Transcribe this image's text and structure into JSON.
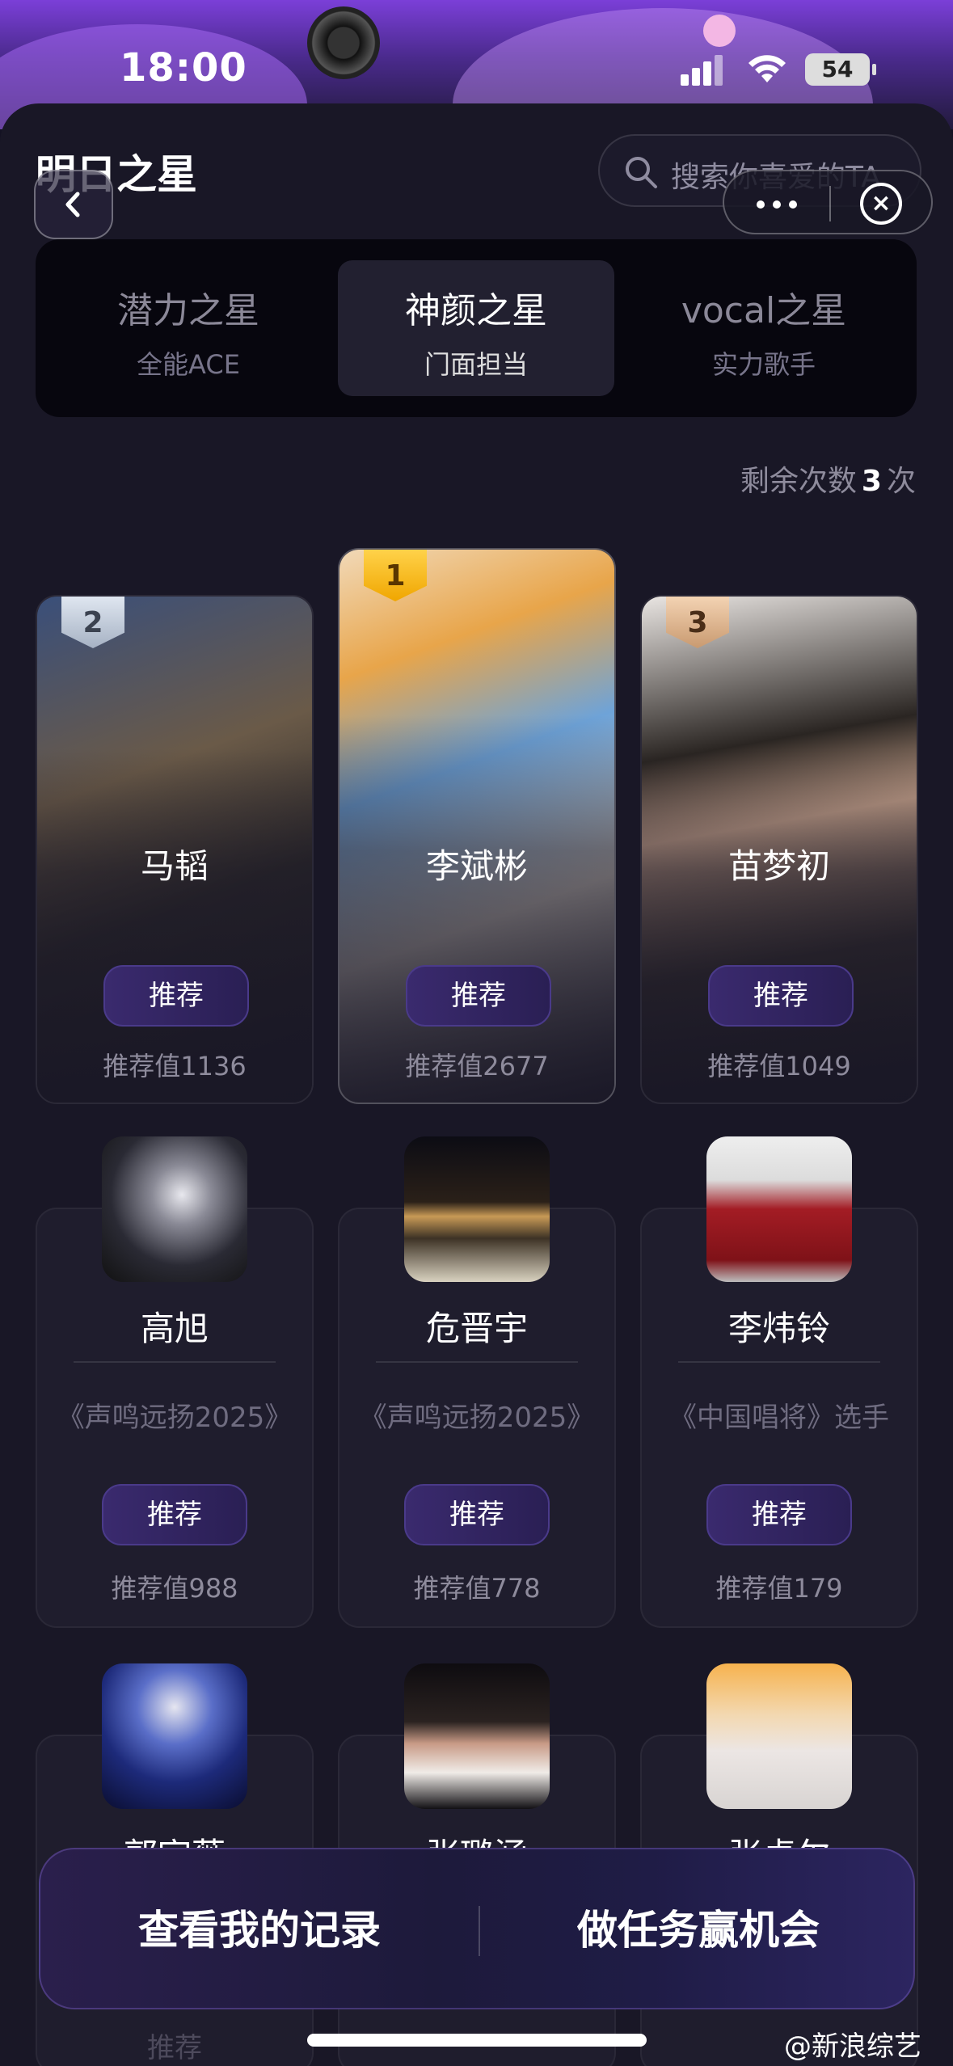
{
  "status": {
    "time": "18:00",
    "battery": "54"
  },
  "header": {
    "title": "明日之星",
    "search_placeholder": "搜索你喜爱的TA"
  },
  "tabs": [
    {
      "title": "潜力之星",
      "subtitle": "全能ACE"
    },
    {
      "title": "神颜之星",
      "subtitle": "门面担当",
      "active": true
    },
    {
      "title": "vocal之星",
      "subtitle": "实力歌手"
    }
  ],
  "remaining": {
    "prefix": "剩余次数",
    "count": "3",
    "suffix": "次"
  },
  "top3": [
    {
      "rank": "2",
      "name": "马韬",
      "button": "推荐",
      "score": "推荐值1136"
    },
    {
      "rank": "1",
      "name": "李斌彬",
      "button": "推荐",
      "score": "推荐值2677"
    },
    {
      "rank": "3",
      "name": "苗梦初",
      "button": "推荐",
      "score": "推荐值1049"
    }
  ],
  "row2": [
    {
      "name": "高旭",
      "subtitle": "《声鸣远扬2025》",
      "button": "推荐",
      "score": "推荐值988"
    },
    {
      "name": "危晋宇",
      "subtitle": "《声鸣远扬2025》",
      "button": "推荐",
      "score": "推荐值778"
    },
    {
      "name": "李炜铃",
      "subtitle": "《中国唱将》选手",
      "button": "推荐",
      "score": "推荐值179"
    }
  ],
  "row3": [
    {
      "name": "郭宇薇"
    },
    {
      "name": "张璐涵"
    },
    {
      "name": "张卓尔"
    }
  ],
  "row3_peek_button": "推荐",
  "bottom_bar": {
    "left": "查看我的记录",
    "right": "做任务赢机会"
  },
  "watermark": "@新浪综艺"
}
